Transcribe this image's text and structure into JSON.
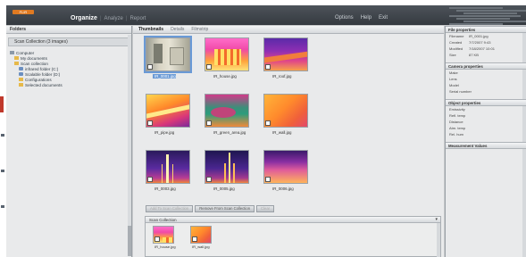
{
  "app": {
    "logo_text": "FLIR",
    "nav": [
      {
        "label": "Organize",
        "active": true
      },
      {
        "label": "Analyze",
        "active": false
      },
      {
        "label": "Report",
        "active": false
      }
    ],
    "menu": [
      "Options",
      "Help",
      "Exit"
    ]
  },
  "folders": {
    "title": "Folders",
    "selected_label": "Scan Collection (3 images)",
    "tree": [
      {
        "label": "Computer",
        "icon": "computer-icon",
        "indent": 0
      },
      {
        "label": "My documents",
        "icon": "folder-icon",
        "indent": 1
      },
      {
        "label": "Scan collection",
        "icon": "folder-icon",
        "indent": 1
      },
      {
        "label": "infrared folder (C:)",
        "icon": "drive-icon",
        "indent": 2
      },
      {
        "label": "Scalable folder (D:)",
        "icon": "drive-icon",
        "indent": 2
      },
      {
        "label": "Configurations",
        "icon": "folder-icon",
        "indent": 2
      },
      {
        "label": "Selected documents",
        "icon": "folder-icon",
        "indent": 2
      }
    ]
  },
  "center": {
    "tabs": [
      {
        "label": "Thumbnails",
        "active": true
      },
      {
        "label": "Details",
        "active": false
      },
      {
        "label": "Filmstrip",
        "active": false
      }
    ],
    "thumbnails": [
      {
        "caption": "IR_0001.jpg",
        "style": "t-room",
        "selected": true
      },
      {
        "caption": "IR_house.jpg",
        "style": "t-house",
        "selected": false
      },
      {
        "caption": "IR_roof.jpg",
        "style": "t-roof",
        "selected": false
      },
      {
        "caption": "IR_pipe.jpg",
        "style": "t-pipe1",
        "selected": false
      },
      {
        "caption": "IR_green_area.jpg",
        "style": "t-green",
        "selected": false
      },
      {
        "caption": "IR_wall.jpg",
        "style": "t-wall",
        "selected": false
      },
      {
        "caption": "IR_0003.jpg",
        "style": "t-tower1",
        "selected": false
      },
      {
        "caption": "IR_0005.jpg",
        "style": "t-tower2",
        "selected": false
      },
      {
        "caption": "IR_0006.jpg",
        "style": "t-pink",
        "selected": false
      }
    ],
    "buttons": [
      {
        "label": "Add To Scan Collection",
        "enabled": false
      },
      {
        "label": "Remove From Scan Collection",
        "enabled": true
      },
      {
        "label": "Clear",
        "enabled": false
      }
    ],
    "collection": {
      "title": "Scan Collection",
      "items": [
        {
          "caption": "IR_house.jpg",
          "style": "t-house"
        },
        {
          "caption": "IR_wall.jpg",
          "style": "t-wall"
        }
      ]
    }
  },
  "properties": {
    "sections": [
      {
        "title": "File properties",
        "rows": [
          {
            "key": "Filename",
            "value": "IR_0001.jpg"
          },
          {
            "key": "Created",
            "value": "7/7/2007 9:43"
          },
          {
            "key": "Modified",
            "value": "7/18/2007 10:01"
          },
          {
            "key": "Size",
            "value": "87 KB"
          }
        ]
      },
      {
        "title": "Camera properties",
        "rows": [
          {
            "key": "Make",
            "value": ""
          },
          {
            "key": "Lens",
            "value": ""
          },
          {
            "key": "Model",
            "value": ""
          },
          {
            "key": "Serial number",
            "value": ""
          }
        ]
      },
      {
        "title": "Object properties",
        "rows": [
          {
            "key": "Emissivity",
            "value": ""
          },
          {
            "key": "Refl. temp",
            "value": ""
          },
          {
            "key": "Distance",
            "value": ""
          },
          {
            "key": "Atm. temp",
            "value": ""
          },
          {
            "key": "Rel. hum",
            "value": ""
          }
        ]
      },
      {
        "title": "Measurement Values",
        "rows": []
      }
    ]
  }
}
